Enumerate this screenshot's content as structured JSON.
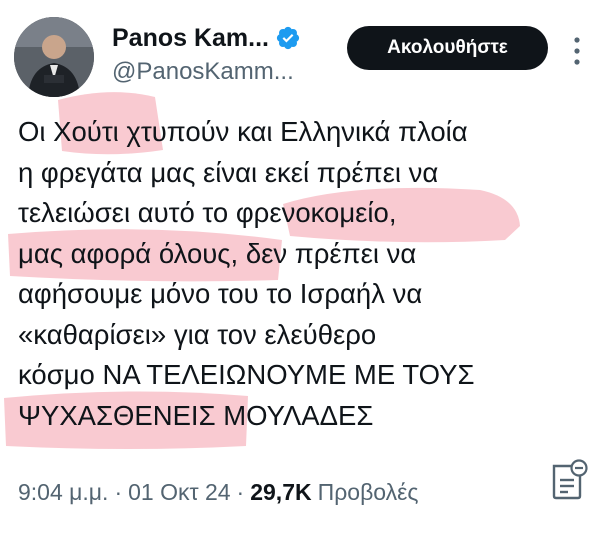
{
  "author": {
    "display_name": "Panos Kam...",
    "handle": "@PanosKamm..."
  },
  "follow_button": {
    "label": "Ακολουθήστε"
  },
  "tweet": {
    "lines": [
      "Οι Χούτι χτυπούν και Ελληνικά πλοία",
      "η φρεγάτα μας είναι εκεί πρέπει να",
      "τελειώσει αυτό το φρενοκομείο,",
      "μας αφορά όλους, δεν πρέπει να",
      "αφήσουμε μόνο του το Ισραήλ να",
      "«καθαρίσει» για τον ελεύθερο",
      "κόσμο ΝΑ ΤΕΛΕΙΩΝΟΥΜΕ ΜΕ ΤΟΥΣ",
      "ΨΥΧΑΣΘΕΝΕΙΣ ΜΟΥΛΑΔΕΣ"
    ]
  },
  "meta": {
    "time": "9:04 μ.μ.",
    "separator": "·",
    "date": "01 Οκτ 24",
    "views_count": "29,7K",
    "views_label": "Προβολές"
  },
  "icons": {
    "verified": "verified-badge-icon",
    "more": "more-options-icon",
    "notes": "community-notes-icon"
  },
  "colors": {
    "verified_blue": "#1d9bf0",
    "button_bg": "#0f1419",
    "highlight": "#f6b4bd",
    "secondary_text": "#536471"
  }
}
